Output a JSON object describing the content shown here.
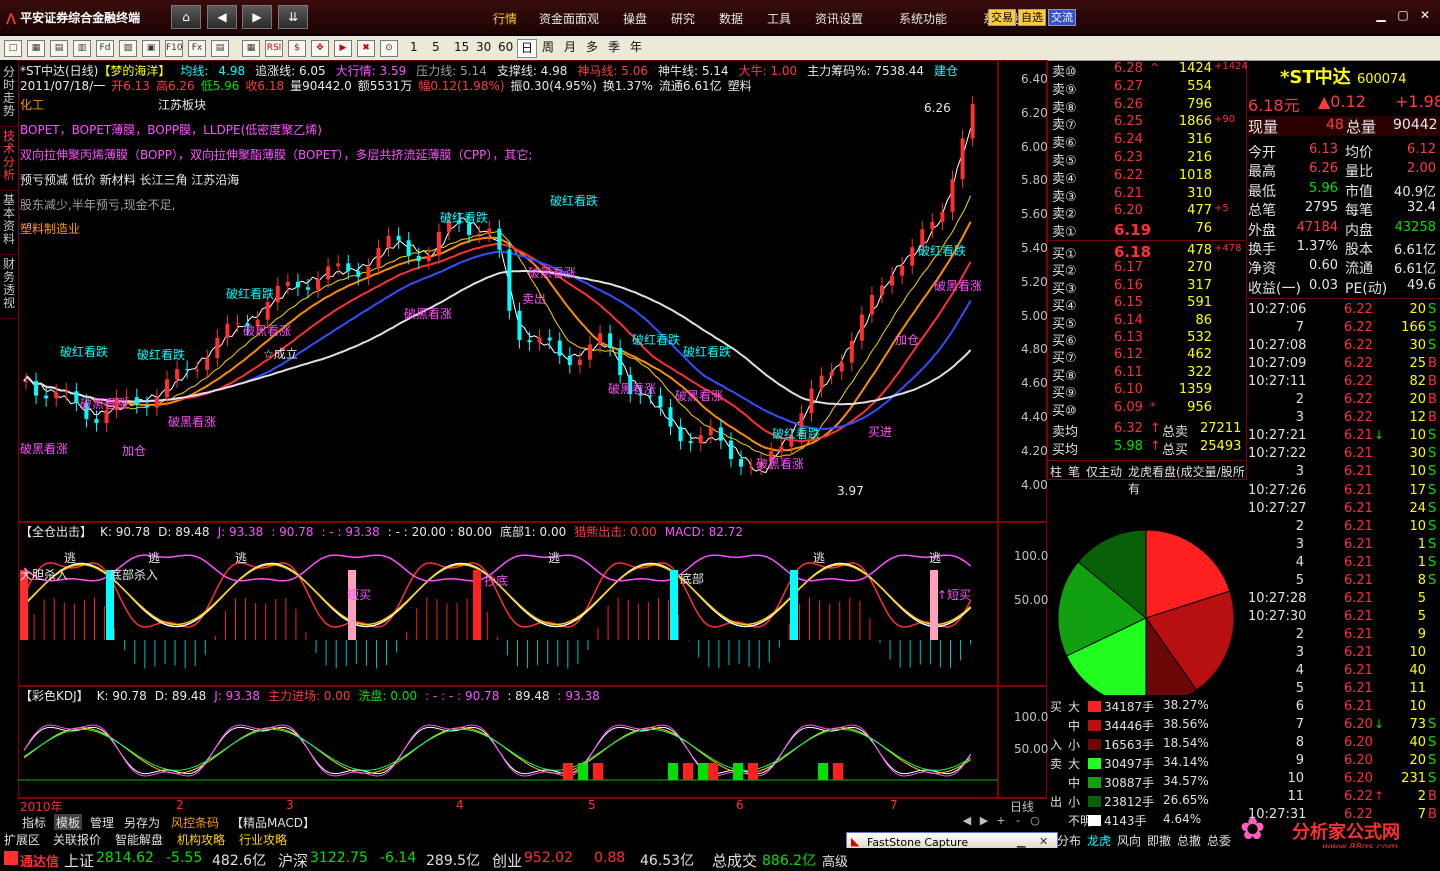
{
  "topbar": {
    "title": "平安证券综合金融终端",
    "menus": [
      "行情",
      "资金面面观",
      "操盘",
      "研究",
      "数据",
      "工具",
      "资讯设置",
      "系统功能",
      "系统设置"
    ],
    "trade_buttons": [
      "交易",
      "自选",
      "交流"
    ]
  },
  "toolbar": {
    "icons": [
      "□",
      "▦",
      "▤",
      "▥",
      "Fd",
      "▨",
      "▣",
      "F10",
      "Fx",
      "▤",
      "▦",
      "RSI",
      "$",
      "✥",
      "▶",
      "✖",
      "⊙"
    ],
    "periods": [
      "1",
      "5",
      "15",
      "30",
      "60",
      "日",
      "周",
      "月",
      "多",
      "季",
      "年"
    ]
  },
  "left_tabs": [
    {
      "label": "分时走势",
      "selected": false
    },
    {
      "label": "技术分析",
      "selected": true
    },
    {
      "label": "基本资料",
      "selected": false
    },
    {
      "label": "财务透视",
      "selected": false
    }
  ],
  "main_chart": {
    "header1": {
      "name": "*ST中达(日线)",
      "indicator": "【梦的海洋】",
      "items": [
        {
          "t": "均线:",
          "c": "cyan"
        },
        {
          "t": "4.98",
          "c": "cyan"
        },
        {
          "t": "追涨线: 6.05",
          "c": "white"
        },
        {
          "t": "大行情: 3.59",
          "c": "magenta"
        },
        {
          "t": "压力线: 5.14",
          "c": "gray"
        },
        {
          "t": "支撑线: 4.98",
          "c": "white"
        },
        {
          "t": "神马线: 5.06",
          "c": "red"
        },
        {
          "t": "神牛线: 5.14",
          "c": "white"
        },
        {
          "t": "大牛: 1.00",
          "c": "red"
        },
        {
          "t": "主力筹码%: 7538.44",
          "c": "white"
        },
        {
          "t": "建仓",
          "c": "cyan"
        }
      ]
    },
    "header2": {
      "date": "2011/07/18/一",
      "open": "开6.13",
      "high": "高6.26",
      "low": "低5.96",
      "close": "收6.18",
      "volume": "量90442.0",
      "amount": "额5531万",
      "change": "幅0.12(1.98%)",
      "amplitude": "振0.30(4.95%)",
      "turnover": "换1.37%",
      "float": "流通6.61亿",
      "sector_tag": "塑料"
    },
    "info_lines": [
      {
        "t": "化工",
        "c": "orange"
      },
      {
        "t": "江苏板块",
        "c": "white"
      },
      {
        "t": "BOPET，BOPET薄膜，BOPP膜，LLDPE(低密度聚乙烯)",
        "c": "magenta"
      },
      {
        "t": "双向拉伸聚丙烯薄膜（BOPP），双向拉伸聚酯薄膜（BOPET），多层共挤流延薄膜（CPP），其它;",
        "c": "magenta"
      },
      {
        "t": "预亏预减 低价 新材料 长江三角 江苏沿海",
        "c": "white"
      },
      {
        "t": "股东减少,半年预亏,现金不足,",
        "c": "gray"
      },
      {
        "t": "塑料制造业",
        "c": "orange"
      }
    ],
    "price_axis": [
      "6.40",
      "6.20",
      "6.00",
      "5.80",
      "5.60",
      "5.40",
      "5.20",
      "5.00",
      "4.80",
      "4.60",
      "4.40",
      "4.20",
      "4.00"
    ],
    "annotations": [
      {
        "t": "6.26",
        "c": "white"
      },
      {
        "t": "3.97",
        "c": "white"
      },
      {
        "t": "破黑看涨",
        "c": "magenta"
      },
      {
        "t": "破红看跌",
        "c": "cyan"
      },
      {
        "t": "加仓",
        "c": "magenta"
      },
      {
        "t": "☆成立",
        "c": "white"
      },
      {
        "t": "买进",
        "c": "magenta"
      },
      {
        "t": "卖出",
        "c": "magenta"
      }
    ],
    "chart_note": "K-line candlesticks with moving averages"
  },
  "sub1": {
    "header": [
      {
        "t": "【全仓出击】",
        "c": "white"
      },
      {
        "t": "K: 90.78",
        "c": "white"
      },
      {
        "t": "D: 89.48",
        "c": "white"
      },
      {
        "t": "J: 93.38",
        "c": "magenta"
      },
      {
        "t": ": 90.78",
        "c": "magenta"
      },
      {
        "t": ": - : 93.38",
        "c": "magenta"
      },
      {
        "t": ": - : 20.00 : 80.00",
        "c": "white"
      },
      {
        "t": "底部1: 0.00",
        "c": "white"
      },
      {
        "t": "猎熊出击: 0.00",
        "c": "red"
      },
      {
        "t": "MACD: 82.72",
        "c": "magenta"
      }
    ],
    "axis": [
      "100.0",
      "50.00"
    ],
    "labels": [
      {
        "t": "逃",
        "c": "white"
      },
      {
        "t": "大胆杀入",
        "c": "white"
      },
      {
        "t": "底部杀入",
        "c": "white"
      },
      {
        "t": "抄底",
        "c": "magenta"
      },
      {
        "t": "底部",
        "c": "white"
      },
      {
        "t": "短买",
        "c": "magenta"
      },
      {
        "t": "↑短买",
        "c": "magenta"
      }
    ]
  },
  "sub2": {
    "header": [
      {
        "t": "【彩色KDJ】",
        "c": "white"
      },
      {
        "t": "K: 90.78",
        "c": "white"
      },
      {
        "t": "D: 89.48",
        "c": "white"
      },
      {
        "t": "J: 93.38",
        "c": "magenta"
      },
      {
        "t": "主力进场: 0.00",
        "c": "red"
      },
      {
        "t": "洗盘: 0.00",
        "c": "green"
      },
      {
        "t": ": - : - : 90.78",
        "c": "magenta"
      },
      {
        "t": ": 89.48",
        "c": "white"
      },
      {
        "t": ": 93.38",
        "c": "magenta"
      }
    ],
    "axis": [
      "100.0",
      "50.00"
    ]
  },
  "time_axis": [
    "2010年",
    "2",
    "3",
    "4",
    "5",
    "6",
    "7"
  ],
  "time_axis_right": "日线",
  "bottom_tabs": [
    "指标",
    "模板",
    "管理",
    "另存为",
    "风控条码",
    "【精品MACD】"
  ],
  "bottom_tabs2": [
    "扩展区",
    "关联报价",
    "智能解盘",
    "机构攻略",
    "行业攻略"
  ],
  "zoom_controls": [
    "◀",
    "▶",
    "+",
    "-",
    "○"
  ],
  "stock": {
    "name": "*ST中达",
    "code": "600074",
    "price": "6.18元",
    "change": "▲0.12",
    "pct": "+1.98",
    "now_vol_label": "现量",
    "now_vol": "48",
    "total_vol_label": "总量",
    "total_vol": "90442"
  },
  "sell_book": [
    {
      "lbl": "卖⑩",
      "p": "6.28",
      "arrow": "^",
      "v": "1424",
      "chg": "+1424"
    },
    {
      "lbl": "卖⑨",
      "p": "6.27",
      "arrow": "",
      "v": "554",
      "chg": ""
    },
    {
      "lbl": "卖⑧",
      "p": "6.26",
      "arrow": "",
      "v": "796",
      "chg": ""
    },
    {
      "lbl": "卖⑦",
      "p": "6.25",
      "arrow": "",
      "v": "1866",
      "chg": "+90"
    },
    {
      "lbl": "卖⑥",
      "p": "6.24",
      "arrow": "",
      "v": "316",
      "chg": ""
    },
    {
      "lbl": "卖⑤",
      "p": "6.23",
      "arrow": "",
      "v": "216",
      "chg": ""
    },
    {
      "lbl": "卖④",
      "p": "6.22",
      "arrow": "",
      "v": "1018",
      "chg": ""
    },
    {
      "lbl": "卖③",
      "p": "6.21",
      "arrow": "",
      "v": "310",
      "chg": ""
    },
    {
      "lbl": "卖②",
      "p": "6.20",
      "arrow": "",
      "v": "477",
      "chg": "+5"
    },
    {
      "lbl": "卖①",
      "p": "6.19",
      "arrow": "",
      "v": "76",
      "chg": ""
    }
  ],
  "buy_book": [
    {
      "lbl": "买①",
      "p": "6.18",
      "arrow": "",
      "v": "478",
      "chg": "+478"
    },
    {
      "lbl": "买②",
      "p": "6.17",
      "arrow": "",
      "v": "270",
      "chg": ""
    },
    {
      "lbl": "买③",
      "p": "6.16",
      "arrow": "",
      "v": "317",
      "chg": ""
    },
    {
      "lbl": "买④",
      "p": "6.15",
      "arrow": "",
      "v": "591",
      "chg": ""
    },
    {
      "lbl": "买⑤",
      "p": "6.14",
      "arrow": "",
      "v": "86",
      "chg": ""
    },
    {
      "lbl": "买⑥",
      "p": "6.13",
      "arrow": "",
      "v": "532",
      "chg": ""
    },
    {
      "lbl": "买⑦",
      "p": "6.12",
      "arrow": "",
      "v": "462",
      "chg": ""
    },
    {
      "lbl": "买⑧",
      "p": "6.11",
      "arrow": "",
      "v": "322",
      "chg": ""
    },
    {
      "lbl": "买⑨",
      "p": "6.10",
      "arrow": "",
      "v": "1359",
      "chg": ""
    },
    {
      "lbl": "买⑩",
      "p": "6.09",
      "arrow": "*",
      "v": "956",
      "chg": ""
    }
  ],
  "book_summary": [
    {
      "lbl": "卖均",
      "p": "6.32",
      "arrow": "↑",
      "k": "总卖",
      "v": "27211"
    },
    {
      "lbl": "买均",
      "p": "5.98",
      "arrow": "↑",
      "k": "总买",
      "v": "25493"
    }
  ],
  "book_tabs": [
    "柱",
    "笔",
    "仅主动",
    "龙虎看盘(成交量/股所有"
  ],
  "quote_info": [
    {
      "k1": "今开",
      "v1": "6.13",
      "c1": "red",
      "k2": "均价",
      "v2": "6.12",
      "c2": "red"
    },
    {
      "k1": "最高",
      "v1": "6.26",
      "c1": "red",
      "k2": "量比",
      "v2": "2.00",
      "c2": "red"
    },
    {
      "k1": "最低",
      "v1": "5.96",
      "c1": "green",
      "k2": "市值",
      "v2": "40.9亿",
      "c2": "white"
    },
    {
      "k1": "总笔",
      "v1": "2795",
      "c1": "white",
      "k2": "每笔",
      "v2": "32.4",
      "c2": "white"
    },
    {
      "k1": "外盘",
      "v1": "47184",
      "c1": "red",
      "k2": "内盘",
      "v2": "43258",
      "c2": "green"
    },
    {
      "k1": "换手",
      "v1": "1.37%",
      "c1": "white",
      "k2": "股本",
      "v2": "6.61亿",
      "c2": "white"
    },
    {
      "k1": "净资",
      "v1": "0.60",
      "c1": "white",
      "k2": "流通",
      "v2": "6.61亿",
      "c2": "white"
    },
    {
      "k1": "收益(一)",
      "v1": "0.03",
      "c1": "white",
      "k2": "PE(动)",
      "v2": "49.6",
      "c2": "white"
    }
  ],
  "ticks": [
    {
      "t": "10:27:06",
      "p": "6.22",
      "a": "",
      "v": "20",
      "s": "S"
    },
    {
      "t": "7",
      "p": "6.22",
      "a": "",
      "v": "166",
      "s": "S"
    },
    {
      "t": "10:27:08",
      "p": "6.22",
      "a": "",
      "v": "30",
      "s": "S"
    },
    {
      "t": "10:27:09",
      "p": "6.22",
      "a": "",
      "v": "25",
      "s": "B"
    },
    {
      "t": "10:27:11",
      "p": "6.22",
      "a": "",
      "v": "82",
      "s": "B"
    },
    {
      "t": "2",
      "p": "6.22",
      "a": "",
      "v": "20",
      "s": "B"
    },
    {
      "t": "3",
      "p": "6.22",
      "a": "",
      "v": "12",
      "s": "B"
    },
    {
      "t": "10:27:21",
      "p": "6.21",
      "a": "↓",
      "v": "10",
      "s": "S"
    },
    {
      "t": "10:27:22",
      "p": "6.21",
      "a": "",
      "v": "30",
      "s": "S"
    },
    {
      "t": "3",
      "p": "6.21",
      "a": "",
      "v": "10",
      "s": "S"
    },
    {
      "t": "10:27:26",
      "p": "6.21",
      "a": "",
      "v": "17",
      "s": "S"
    },
    {
      "t": "10:27:27",
      "p": "6.21",
      "a": "",
      "v": "24",
      "s": "S"
    },
    {
      "t": "2",
      "p": "6.21",
      "a": "",
      "v": "10",
      "s": "S"
    },
    {
      "t": "3",
      "p": "6.21",
      "a": "",
      "v": "1",
      "s": "S"
    },
    {
      "t": "4",
      "p": "6.21",
      "a": "",
      "v": "1",
      "s": "S"
    },
    {
      "t": "5",
      "p": "6.21",
      "a": "",
      "v": "8",
      "s": "S"
    },
    {
      "t": "10:27:28",
      "p": "6.21",
      "a": "",
      "v": "5",
      "s": ""
    },
    {
      "t": "10:27:30",
      "p": "6.21",
      "a": "",
      "v": "5",
      "s": ""
    },
    {
      "t": "2",
      "p": "6.21",
      "a": "",
      "v": "9",
      "s": ""
    },
    {
      "t": "3",
      "p": "6.21",
      "a": "",
      "v": "10",
      "s": ""
    },
    {
      "t": "4",
      "p": "6.21",
      "a": "",
      "v": "40",
      "s": ""
    },
    {
      "t": "5",
      "p": "6.21",
      "a": "",
      "v": "11",
      "s": ""
    },
    {
      "t": "6",
      "p": "6.21",
      "a": "",
      "v": "10",
      "s": ""
    },
    {
      "t": "7",
      "p": "6.20",
      "a": "↓",
      "v": "73",
      "s": "S"
    },
    {
      "t": "8",
      "p": "6.20",
      "a": "",
      "v": "40",
      "s": "S"
    },
    {
      "t": "9",
      "p": "6.20",
      "a": "",
      "v": "20",
      "s": "S"
    },
    {
      "t": "10",
      "p": "6.20",
      "a": "",
      "v": "231",
      "s": "S"
    },
    {
      "t": "11",
      "p": "6.22",
      "a": "↑",
      "v": "2",
      "s": "B"
    },
    {
      "t": "10:27:31",
      "p": "6.22",
      "a": "",
      "v": "7",
      "s": "B"
    }
  ],
  "flow": [
    {
      "side": "买",
      "size": "大",
      "v": "34187手",
      "pct": "38.27%",
      "color": "#ff2020"
    },
    {
      "side": "",
      "size": "中",
      "v": "34446手",
      "pct": "38.56%",
      "color": "#b81010"
    },
    {
      "side": "入",
      "size": "小",
      "v": "16563手",
      "pct": "18.54%",
      "color": "#6a0808"
    },
    {
      "side": "卖",
      "size": "大",
      "v": "30497手",
      "pct": "34.14%",
      "color": "#20ff20"
    },
    {
      "side": "",
      "size": "中",
      "v": "30887手",
      "pct": "34.57%",
      "color": "#10a010"
    },
    {
      "side": "出",
      "size": "小",
      "v": "23812手",
      "pct": "26.65%",
      "color": "#086008"
    },
    {
      "side": "",
      "size": "不明",
      "v": "4143手",
      "pct": "4.64%",
      "color": "#ffffff"
    }
  ],
  "flow_pie": [
    38.27,
    38.56,
    18.54,
    34.14,
    34.57,
    26.65,
    4.64
  ],
  "right_bottom_tabs": [
    "列",
    "分布",
    "龙虎",
    "风向",
    "即撤",
    "总撤",
    "总委"
  ],
  "popup": {
    "title": "FastStone Capture"
  },
  "watermark": {
    "text": "分析家公式网",
    "url": "www.88gs.com"
  },
  "status": {
    "brand": "通达信",
    "items": [
      {
        "k": "上证",
        "v": "2814.62",
        "c": "-5.55",
        "amt": "482.6亿"
      },
      {
        "k": "沪深",
        "v": "3122.75",
        "c": "-6.14",
        "amt": "289.5亿"
      },
      {
        "k": "创业",
        "v": "952.02",
        "c": "0.88",
        "amt": "46.53亿"
      },
      {
        "k": "总成交",
        "v": "886.2亿",
        "c": "",
        "amt": ""
      }
    ],
    "tail": "高级"
  }
}
